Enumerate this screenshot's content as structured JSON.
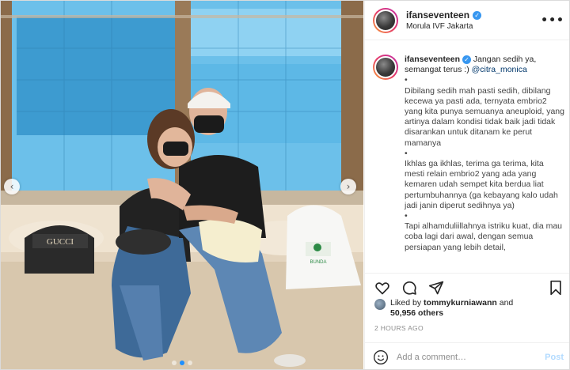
{
  "post": {
    "username": "ifanseventeen",
    "location": "Morula IVF Jakarta",
    "more_label": "•••",
    "bag_text": "GUCCI",
    "shopping_bag_text": "BUNDA"
  },
  "caption": {
    "username": "ifanseventeen",
    "intro": "Jangan sedih ya, semangat terus :)",
    "mention": "@citra_monica",
    "bullet": "•",
    "para1": "Dibilang sedih mah pasti sedih, dibilang kecewa ya pasti ada, ternyata embrio2 yang kita punya semuanya aneuploid, yang artinya dalam kondisi tidak baik jadi tidak disarankan untuk ditanam ke perut mamanya",
    "para2": "Ikhlas ga ikhlas, terima ga terima, kita mesti relain embrio2 yang ada yang kemaren udah sempet kita berdua liat pertumbuhannya (ga kebayang kalo udah jadi janin diperut sedihnya ya)",
    "para3": "Tapi alhamduliillahnya istriku kuat, dia mau coba lagi dari awal, dengan semua persiapan yang lebih detail,"
  },
  "likes": {
    "prefix": "Liked by",
    "user": "tommykurniawann",
    "and": "and",
    "count": "50,956 others"
  },
  "time": "2 HOURS AGO",
  "comment": {
    "placeholder": "Add a comment…",
    "post_label": "Post"
  },
  "carousel": {
    "prev_label": "‹",
    "next_label": "›"
  },
  "colors": {
    "verified": "#3897f0",
    "mention": "#00376b",
    "post_disabled": "#b3dbff",
    "active_dot": "#1e90ff"
  },
  "icons": [
    "verified-badge-icon",
    "more-options-icon",
    "heart-icon",
    "comment-icon",
    "share-icon",
    "bookmark-icon",
    "emoji-icon",
    "chevron-left-icon",
    "chevron-right-icon"
  ]
}
